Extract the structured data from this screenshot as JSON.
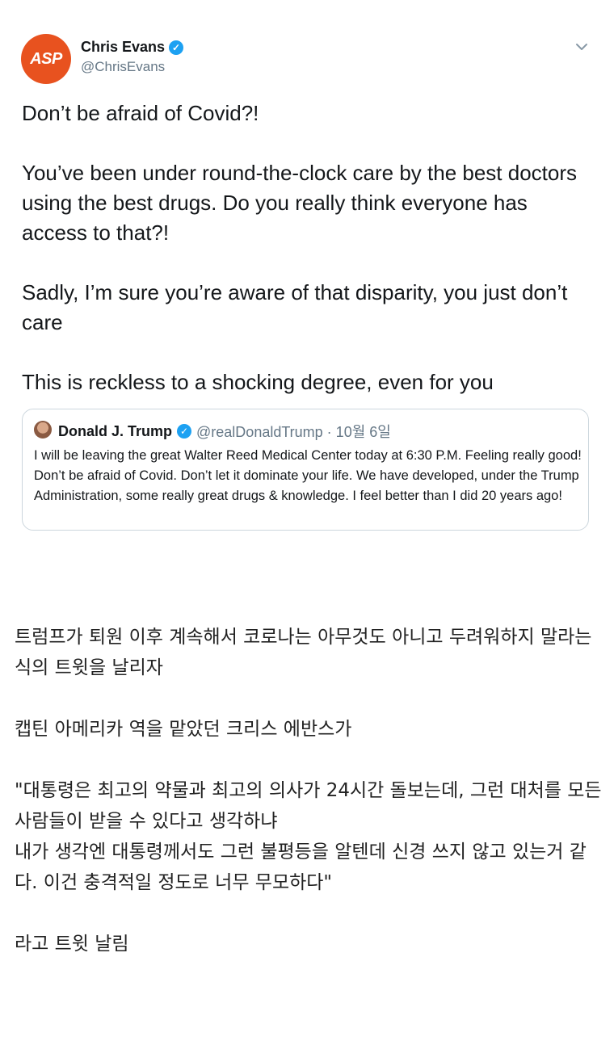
{
  "tweet": {
    "author": {
      "avatar_text": "ASP",
      "avatar_color": "#e8521f",
      "name": "Chris Evans",
      "handle": "@ChrisEvans",
      "verified": true
    },
    "menu_icon": "chevron-down-icon",
    "paragraphs": [
      "Don’t be afraid of Covid?!",
      "You’ve been under round-the-clock care by the best doctors using the best drugs. Do you really think everyone has access to that?!",
      "Sadly, I’m sure you’re aware of that disparity, you just don’t care",
      "This is reckless to a shocking degree, even for you"
    ],
    "quoted": {
      "name": "Donald J. Trump",
      "verified": true,
      "meta": "@realDonaldTrump · 10월 6일",
      "text": "I will be leaving the great Walter Reed Medical Center today at 6:30 P.M. Feeling really good! Don’t be afraid of Covid. Don’t let it dominate your life. We have developed, under the Trump Administration, some really great drugs & knowledge. I feel better than I did 20 years ago!"
    }
  },
  "caption": {
    "p1": "트럼프가 퇴원 이후 계속해서 코로나는 아무것도 아니고 두려워하지 말라는 식의 트윗을 날리자",
    "p2": "캡틴 아메리카 역을 맡았던 크리스 에반스가",
    "p3a": "\"대통령은 최고의 약물과 최고의 의사가 24시간 돌보는데, 그런 대처를 모든 사람들이 받을 수 있다고 생각하냐",
    "p3b": "내가 생각엔 대통령께서도 그런 불평등을 알텐데 신경 쓰지 않고 있는거 같다. 이건 충격적일 정도로 너무 무모하다\"",
    "p4": "라고 트윗 날림"
  },
  "colors": {
    "verified_blue": "#1da1f2",
    "secondary_text": "#657786",
    "border": "#ccd6dd"
  }
}
